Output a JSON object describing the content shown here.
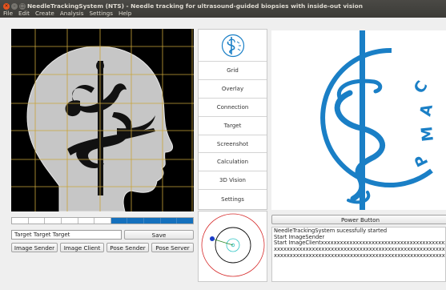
{
  "window": {
    "title": "NeedleTrackingSystem (NTS) - Needle tracking for ultrasound-guided biopsies with inside-out vision"
  },
  "menu": [
    "File",
    "Edit",
    "Create",
    "Analysis",
    "Settings",
    "Help"
  ],
  "progress": {
    "segments": 11,
    "filled": 5
  },
  "target_input": {
    "value": "Target Target Target"
  },
  "buttons": {
    "save": "Save",
    "image_sender": "Image Sender",
    "image_client": "Image Client",
    "pose_sender": "Pose Sender",
    "pose_server": "Pose Server",
    "power": "Power Button"
  },
  "side_menu": [
    "Grid",
    "Overlay",
    "Connection",
    "Target",
    "Screenshot",
    "Calculation",
    "3D Vision",
    "Settings"
  ],
  "logo": {
    "text": "CAMP",
    "color": "#1a7fc6"
  },
  "log": {
    "lines": [
      "NeedleTrackingSystem sucessfully started",
      "Start ImageSender",
      "Start ImageClientxxxxxxxxxxxxxxxxxxxxxxxxxxxxxxxxxxxxxxxxxxxx",
      "xxxxxxxxxxxxxxxxxxxxxxxxxxxxxxxxxxxxxxxxxxxxxxxxxxxxxxxxxxxxxxxxx",
      "xxxxxxxxxxxxxxxxxxxxxxxxxxxxxxxxxxxxxxxxxxxxxxxxxxxxxxxxxxxxxxxxx"
    ]
  },
  "colors": {
    "accent": "#1470bd",
    "grid": "#c9a43a",
    "radar_outer": "#d62a2a",
    "radar_target": "#2ec4c4",
    "radar_needle": "#1a3cc8",
    "radar_line": "#2a8a2a"
  }
}
